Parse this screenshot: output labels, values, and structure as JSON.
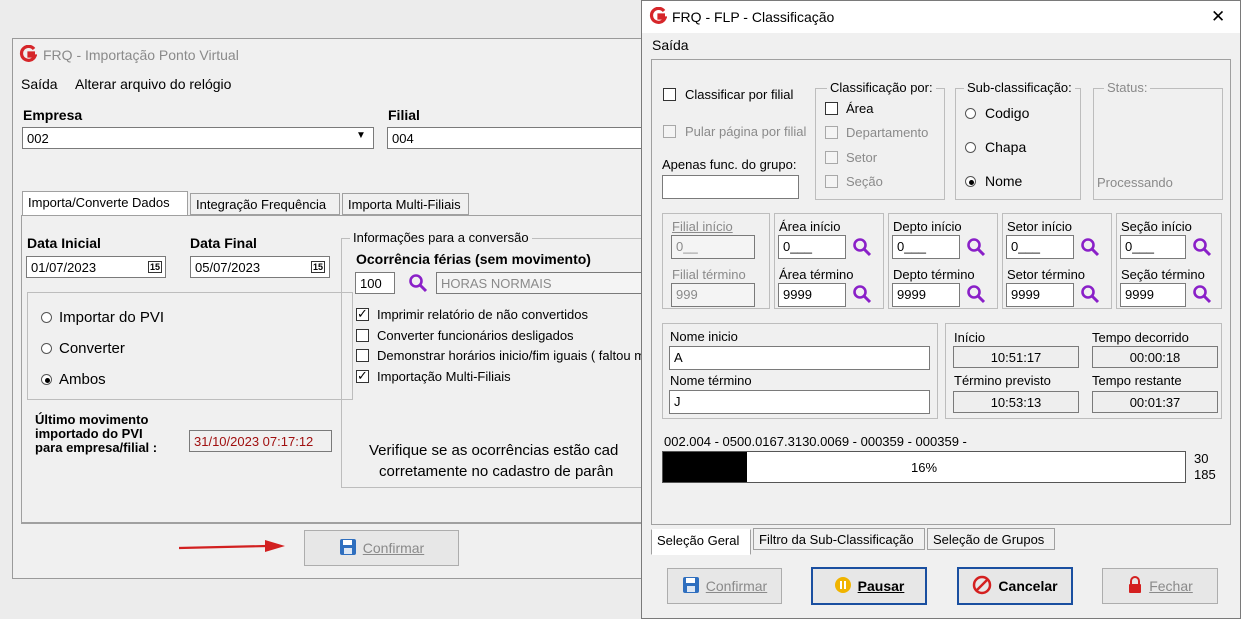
{
  "bg_window": {
    "title": "FRQ - Importação Ponto Virtual",
    "menu": [
      "Saída",
      "Alterar arquivo do relógio"
    ],
    "empresa_label": "Empresa",
    "empresa_value": "002",
    "filial_label": "Filial",
    "filial_value": "004",
    "tabs": [
      "Importa/Converte Dados",
      "Integração Frequência",
      "Importa Multi-Filiais"
    ],
    "data_inicial_label": "Data Inicial",
    "data_inicial_value": "01/07/2023",
    "data_final_label": "Data Final",
    "data_final_value": "05/07/2023",
    "cal_icon": "15",
    "radios": [
      "Importar do PVI",
      "Converter",
      "Ambos"
    ],
    "radio_selected": "Ambos",
    "ultimo_label_1": "Último movimento",
    "ultimo_label_2": "importado do PVI",
    "ultimo_label_3": "para empresa/filial :",
    "ultimo_value": "31/10/2023  07:17:12",
    "conversao_legend": "Informações para a conversão",
    "ocorrencia_label": "Ocorrência férias (sem movimento)",
    "ocorrencia_code": "100",
    "ocorrencia_desc": "HORAS NORMAIS",
    "checks": [
      {
        "label": "Imprimir relatório de não convertidos",
        "checked": true
      },
      {
        "label": "Converter funcionários desligados",
        "checked": false
      },
      {
        "label": "Demonstrar horários inicio/fim iguais ( faltou m",
        "checked": false
      },
      {
        "label": "Importação Multi-Filiais",
        "checked": true
      }
    ],
    "verifique_1": "Verifique se as ocorrências estão cad",
    "verifique_2": "corretamente  no cadastro de parân",
    "confirm_label": "Confirmar"
  },
  "dialog": {
    "title": "FRQ - FLP - Classificação",
    "close_glyph": "✕",
    "menu": [
      "Saída"
    ],
    "classificar_por_filial": "Classificar por filial",
    "pular_pagina": "Pular página por filial",
    "apenas_func": "Apenas func. do grupo:",
    "classificacao_legend": "Classificação  por:",
    "classificacao_items": [
      "Área",
      "Departamento",
      "Setor",
      "Seção"
    ],
    "subclass_legend": "Sub-classificação:",
    "subclass_items": [
      "Codigo",
      "Chapa",
      "Nome"
    ],
    "subclass_selected": "Nome",
    "status_legend": "Status:",
    "status_value": "Processando",
    "ranges": [
      {
        "start_label": "Filial início",
        "start_value": "0__",
        "end_label": "Filial término",
        "end_value": "999",
        "disabled": true
      },
      {
        "start_label": "Área início",
        "start_value": "0___",
        "end_label": "Área término",
        "end_value": "9999",
        "disabled": false
      },
      {
        "start_label": "Depto início",
        "start_value": "0___",
        "end_label": "Depto término",
        "end_value": "9999",
        "disabled": false
      },
      {
        "start_label": "Setor início",
        "start_value": "0___",
        "end_label": "Setor término",
        "end_value": "9999",
        "disabled": false
      },
      {
        "start_label": "Seção início",
        "start_value": "0___",
        "end_label": "Seção término",
        "end_value": "9999",
        "disabled": false
      }
    ],
    "nome_inicio_label": "Nome inicio",
    "nome_inicio_value": "A",
    "nome_termino_label": "Nome término",
    "nome_termino_value": "J",
    "inicio_label": "Início",
    "inicio_value": "10:51:17",
    "decorrido_label": "Tempo decorrido",
    "decorrido_value": "00:00:18",
    "termino_label": "Término previsto",
    "termino_value": "10:53:13",
    "restante_label": "Tempo restante",
    "restante_value": "00:01:37",
    "progress_text": "002.004 - 0500.0167.3130.0069 - 000359 - 000359 -",
    "progress_percent_label": "16%",
    "progress_fraction": 0.16,
    "count_current": "30",
    "count_total": "185",
    "tabs": [
      "Seleção Geral",
      "Filtro da Sub-Classificação",
      "Seleção de Grupos"
    ],
    "buttons": {
      "confirmar": "Confirmar",
      "pausar": "Pausar",
      "cancelar": "Cancelar",
      "fechar": "Fechar"
    }
  },
  "colors": {
    "logo_red": "#d6262a",
    "search_purple": "#8a20c8",
    "arrow_red": "#d22020",
    "date_red": "#a01010",
    "progress_fill": "#000000"
  }
}
